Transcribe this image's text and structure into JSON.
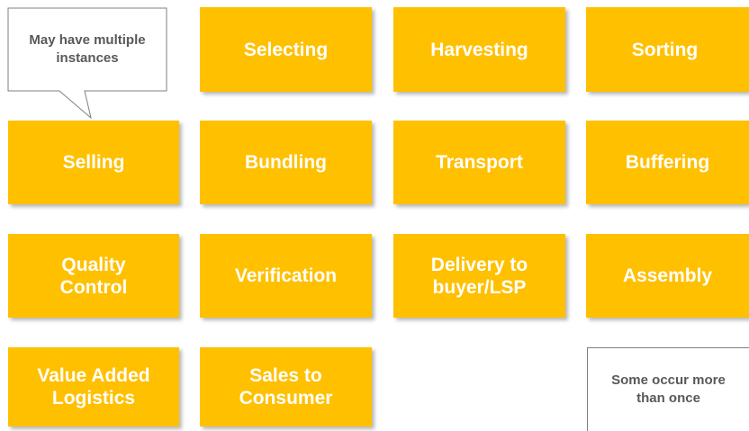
{
  "tiles": {
    "selecting": "Selecting",
    "harvesting": "Harvesting",
    "sorting": "Sorting",
    "selling": "Selling",
    "bundling": "Bundling",
    "transport": "Transport",
    "buffering": "Buffering",
    "quality_control": "Quality\nControl",
    "verification": "Verification",
    "delivery": "Delivery to\nbuyer/LSP",
    "assembly": "Assembly",
    "value_added_logistics": "Value Added\nLogistics",
    "sales_to_consumer": "Sales to\nConsumer"
  },
  "notes": {
    "multiple_instances": "May have multiple\ninstances",
    "occur_more_than_once": "Some occur more\nthan once"
  },
  "colors": {
    "tile_fill": "#FFC000",
    "tile_text": "#FFFFFF",
    "note_border": "#7F7F7F",
    "note_text": "#595959"
  }
}
